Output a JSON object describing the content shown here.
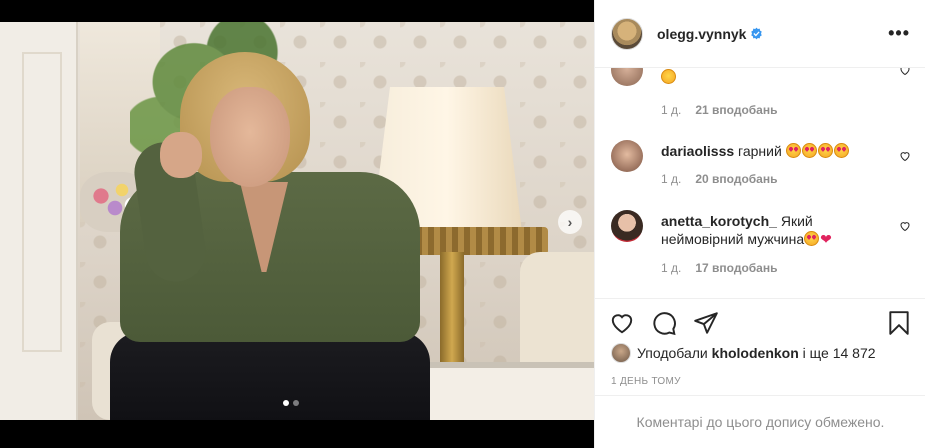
{
  "header": {
    "username": "olegg.vynnyk",
    "more_label": "•••"
  },
  "comments": [
    {
      "user": "",
      "text": "",
      "emoji": [
        "grin"
      ],
      "time": "1 д.",
      "likes": "21 вподобань"
    },
    {
      "user": "dariaolisss",
      "text": "гарний",
      "emoji": [
        "heart-eyes",
        "heart-eyes",
        "heart-eyes",
        "heart-eyes"
      ],
      "time": "1 д.",
      "likes": "20 вподобань"
    },
    {
      "user": "anetta_korotych_",
      "text": "Який неймовірний мужчина",
      "emoji": [
        "heart-eyes",
        "red-heart"
      ],
      "time": "1 д.",
      "likes": "17 вподобань"
    }
  ],
  "likes": {
    "prefix": "Уподобали",
    "user": "kholodenkon",
    "suffix": "і ще 14 872"
  },
  "post_date": "1 ДЕНЬ ТОМУ",
  "comments_closed": "Коментарі до цього допису обмежено.",
  "carousel": {
    "next_label": "›",
    "current_index": 0,
    "total": 2
  },
  "colors": {
    "accent_blue": "#3897f0",
    "text": "#262626",
    "muted": "#8e8e8e",
    "divider": "#efefef"
  },
  "icons": [
    "heart-icon",
    "comment-icon",
    "share-icon",
    "bookmark-icon",
    "verified-badge-icon",
    "more-options-icon"
  ]
}
